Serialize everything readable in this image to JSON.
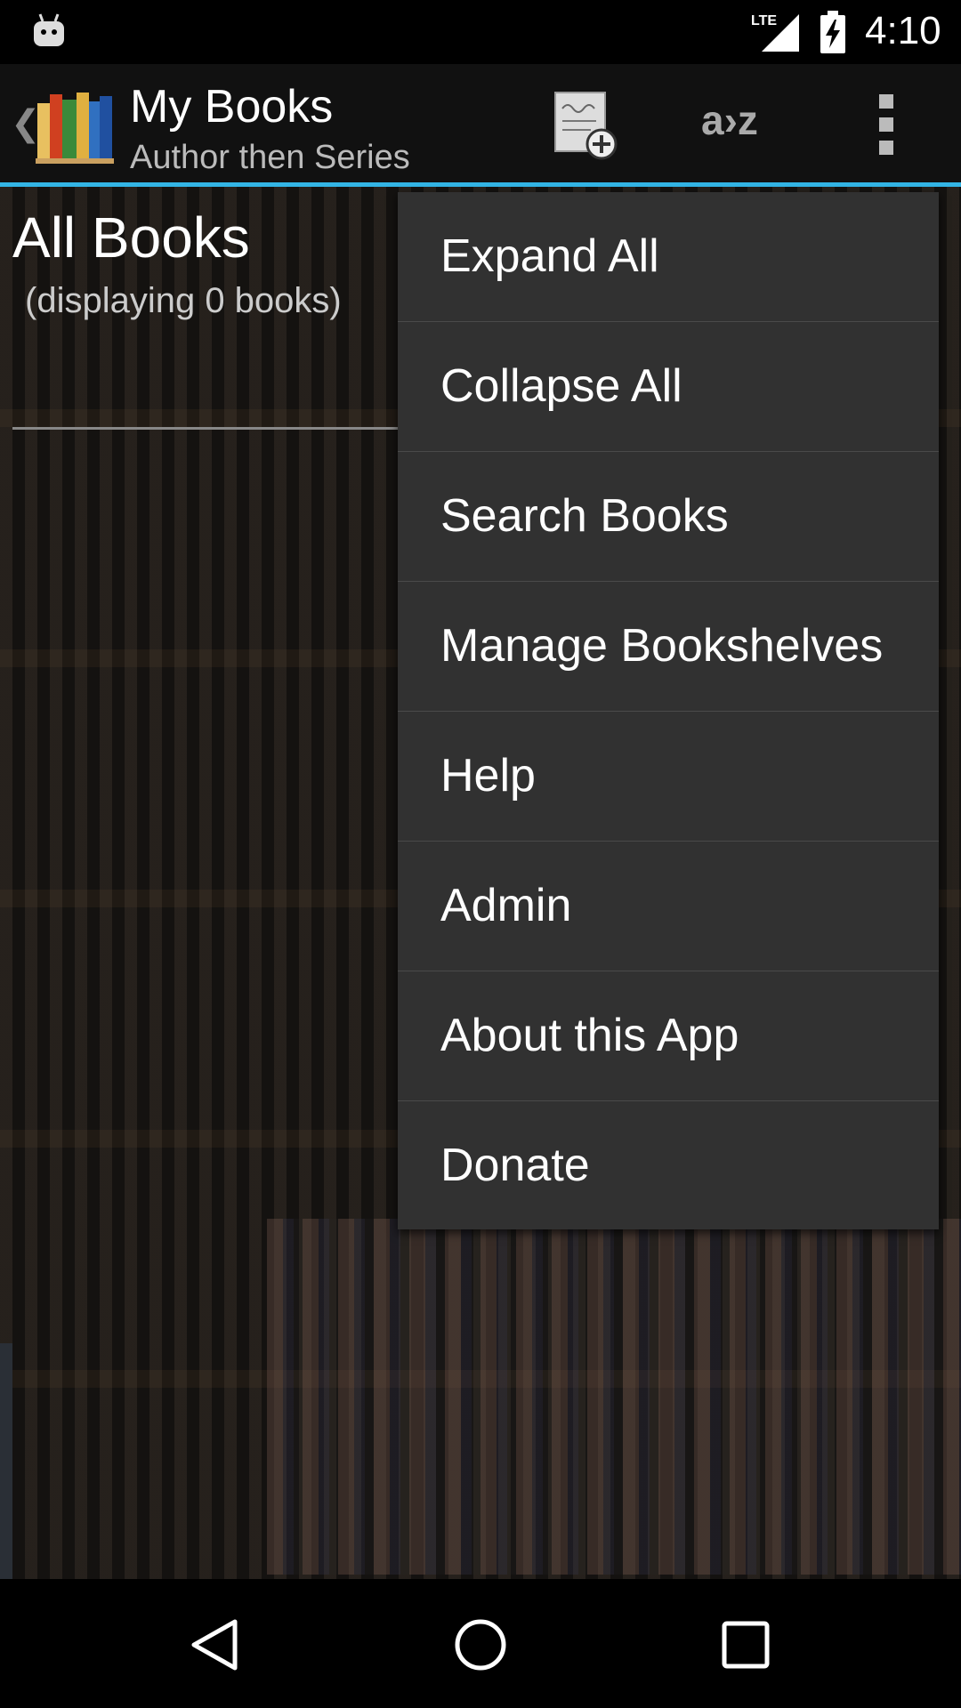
{
  "status_bar": {
    "time": "4:10",
    "network": "LTE",
    "icons": [
      "android-icon",
      "lte-signal-icon",
      "battery-charging-icon"
    ]
  },
  "action_bar": {
    "title": "My Books",
    "subtitle": "Author then Series",
    "sort_label": "a›z",
    "icons": [
      "up-caret-icon",
      "app-logo-icon",
      "add-book-icon",
      "overflow-menu-icon"
    ],
    "accent_color": "#33b5e5"
  },
  "list_header": {
    "title": "All Books",
    "count_text": "(displaying 0 books)"
  },
  "menu": {
    "items": [
      {
        "label": "Expand All"
      },
      {
        "label": "Collapse All"
      },
      {
        "label": "Search Books"
      },
      {
        "label": "Manage Bookshelves"
      },
      {
        "label": "Help"
      },
      {
        "label": "Admin"
      },
      {
        "label": "About this App"
      },
      {
        "label": "Donate"
      }
    ]
  },
  "nav_bar": {
    "icons": [
      "back-icon",
      "home-icon",
      "recents-icon"
    ]
  }
}
